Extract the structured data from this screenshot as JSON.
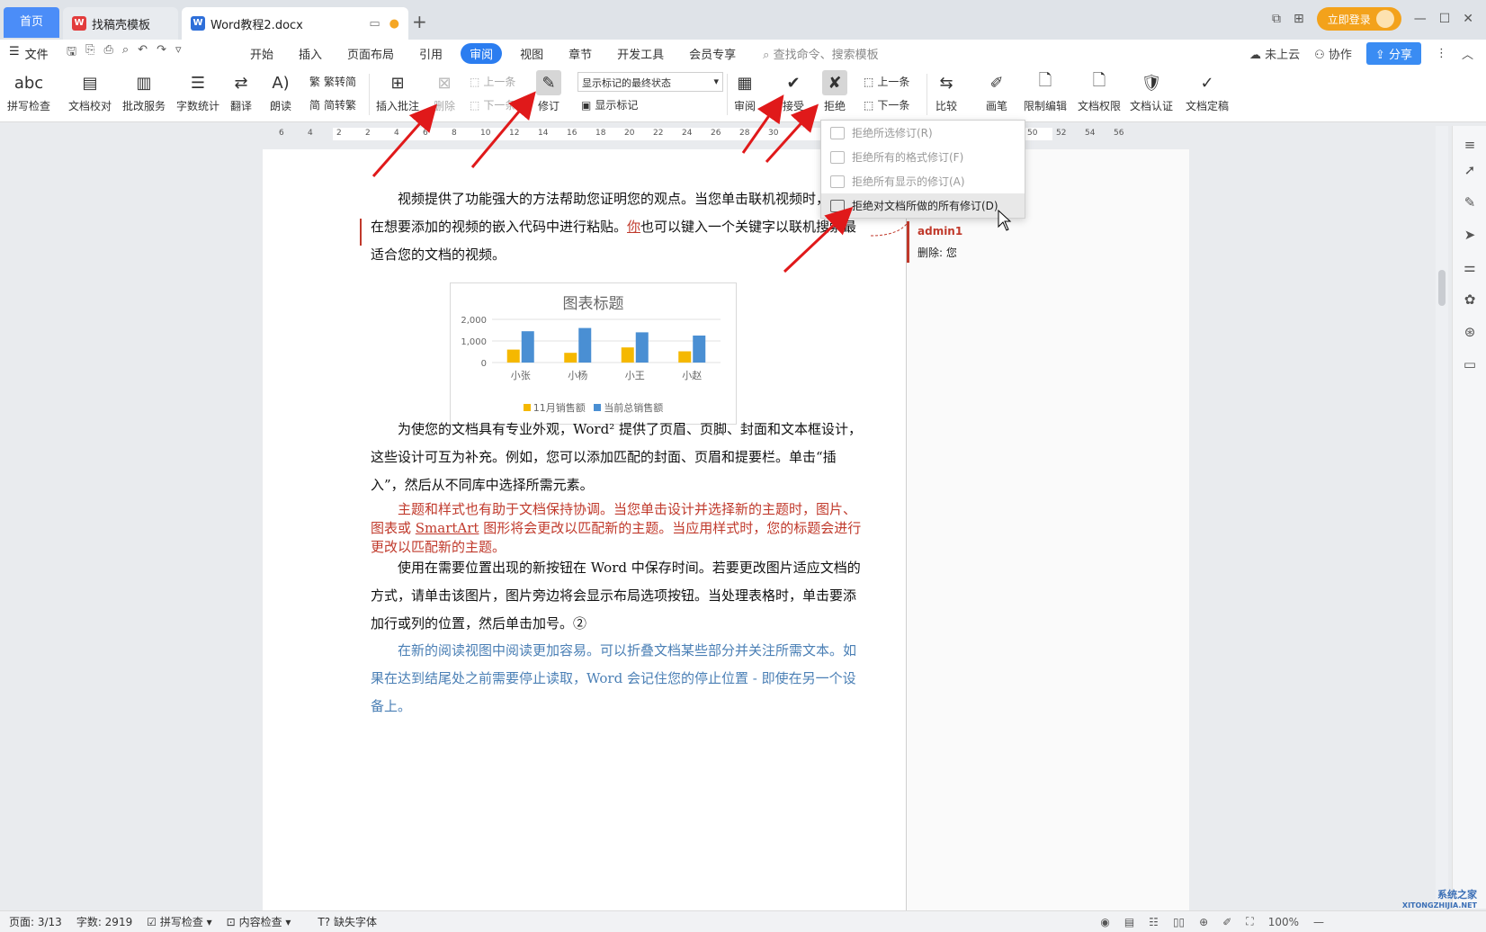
{
  "tabs": {
    "home": "首页",
    "template": "找稿壳模板",
    "doc": "Word教程2.docx",
    "login": "立即登录"
  },
  "menubar": {
    "file": "文件",
    "tabs": [
      "开始",
      "插入",
      "页面布局",
      "引用",
      "审阅",
      "视图",
      "章节",
      "开发工具",
      "会员专享"
    ],
    "active_tab": "审阅",
    "search": "查找命令、搜索模板",
    "cloud": "未上云",
    "collab": "协作",
    "share": "分享"
  },
  "ribbon": {
    "spell": "拼写检查",
    "proofread": "文档校对",
    "batch": "批改服务",
    "wordcount": "字数统计",
    "translate": "翻译",
    "read": "朗读",
    "trad": "繁转简",
    "simp": "简转繁",
    "insert_comment": "插入批注",
    "delete": "删除",
    "prev_comment": "上一条",
    "next_comment": "下一条",
    "track": "修订",
    "markup_state": "显示标记的最终状态",
    "show_markup": "显示标记",
    "review": "审阅",
    "accept": "接受",
    "reject": "拒绝",
    "prev": "上一条",
    "next": "下一条",
    "compare": "比较",
    "pen": "画笔",
    "restrict": "限制编辑",
    "perm": "文档权限",
    "cert": "文档认证",
    "finalize": "文档定稿"
  },
  "dropdown": {
    "items": [
      "拒绝所选修订(R)",
      "拒绝所有的格式修订(F)",
      "拒绝所有显示的修订(A)",
      "拒绝对文档所做的所有修订(D)"
    ],
    "hover_index": 3
  },
  "ruler": [
    "6",
    "4",
    "2",
    "2",
    "4",
    "6",
    "8",
    "10",
    "12",
    "14",
    "16",
    "18",
    "20",
    "22",
    "24",
    "26",
    "28",
    "30",
    "",
    "",
    "",
    "",
    "",
    "",
    "46",
    "48",
    "50",
    "52",
    "54",
    "56"
  ],
  "document": {
    "p1_a": "视频提供了功能强大的方法帮助您证明您的观点。当您单击联机视频时，可",
    "p1_b": "以在想要添加的视频的嵌入代码中进行粘贴。",
    "p1_del": "你",
    "p1_c": "也可以键入一个关键字以联机搜索最适合您的文档的视频。",
    "p2": "为使您的文档具有专业外观，Word² 提供了页眉、页脚、封面和文本框设计，这些设计可互为补充。例如，您可以添加匹配的封面、页眉和提要栏。单击“插入”，然后从不同库中选择所需元素。",
    "p3_a": "主题和样式也有助于文档保持协调。当您单击设计并选择新的主题时，图片、图表或 ",
    "p3_u": "SmartArt",
    "p3_b": " 图形将会更改以匹配新的主题。当应用样式时，您的标题会进行更改以匹配新的主题。",
    "p4": "使用在需要位置出现的新按钮在 Word 中保存时间。若要更改图片适应文档的方式，请单击该图片，图片旁边将会显示布局选项按钮。当处理表格时，单击要添加行或列的位置，然后单击加号。②",
    "p5": "在新的阅读视图中阅读更加容易。可以折叠文档某些部分并关注所需文本。如果在达到结尾处之前需要停止读取，Word 会记住您的停止位置 - 即使在另一个设备上。"
  },
  "comment": {
    "author": "admin1",
    "text": "删除: 您"
  },
  "chart_data": {
    "type": "bar",
    "title": "图表标题",
    "categories": [
      "小张",
      "小杨",
      "小王",
      "小赵"
    ],
    "series": [
      {
        "name": "11月销售额",
        "values": [
          600,
          450,
          700,
          520
        ],
        "color": "#f5b800"
      },
      {
        "name": "当前总销售额",
        "values": [
          1450,
          1600,
          1400,
          1250
        ],
        "color": "#4a8fd3"
      }
    ],
    "yticks": [
      "2,000",
      "1,000",
      "0"
    ],
    "ylim": [
      0,
      2000
    ]
  },
  "status": {
    "page": "页面: 3/13",
    "words": "字数: 2919",
    "spell": "拼写检查",
    "content": "内容检查",
    "font": "缺失字体",
    "zoom": "100%"
  },
  "watermark": "系统之家",
  "watermark_url": "XITONGZHIJIA.NET"
}
